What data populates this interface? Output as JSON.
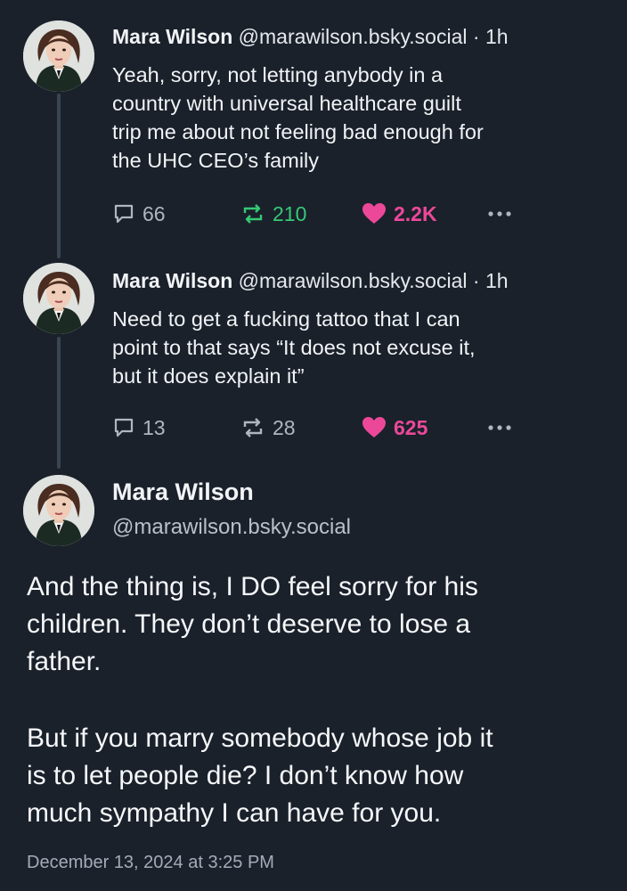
{
  "colors": {
    "background": "#1a212b",
    "text": "#f1f3f5",
    "muted": "#aeb6c0",
    "repost_active": "#35c975",
    "like_active": "#ec4899",
    "thread_line": "#3a4554"
  },
  "replies": [
    {
      "author_name": "Mara Wilson",
      "handle": "@marawilson.bsky.social",
      "separator": "·",
      "time": "1h",
      "lines": [
        "Yeah, sorry, not letting anybody in a",
        "country with universal healthcare guilt",
        "trip me about not feeling bad enough for",
        "the UHC CEO’s family"
      ],
      "reply_count": "66",
      "repost_count": "210",
      "like_count": "2.2K",
      "reposted": true,
      "liked": true
    },
    {
      "author_name": "Mara Wilson",
      "handle": "@marawilson.bsky.social",
      "separator": "·",
      "time": "1h",
      "lines": [
        "Need to get a fucking tattoo that I can",
        "point to that says “It does not excuse it,",
        "but it does explain it”"
      ],
      "reply_count": "13",
      "repost_count": "28",
      "like_count": "625",
      "reposted": false,
      "liked": true
    }
  ],
  "main_post": {
    "author_name": "Mara Wilson",
    "handle": "@marawilson.bsky.social",
    "paragraph_1": [
      "And the thing is, I DO feel sorry for his",
      "children. They don’t deserve to lose a",
      "father."
    ],
    "paragraph_2": [
      "But if you marry somebody whose job it",
      "is to let people die? I don’t know how",
      "much sympathy I can have for you."
    ],
    "timestamp": "December 13, 2024 at 3:25 PM"
  },
  "icons": {
    "reply": "speech-bubble-icon",
    "repost": "repost-arrows-icon",
    "like": "heart-icon",
    "more": "ellipsis-icon"
  }
}
